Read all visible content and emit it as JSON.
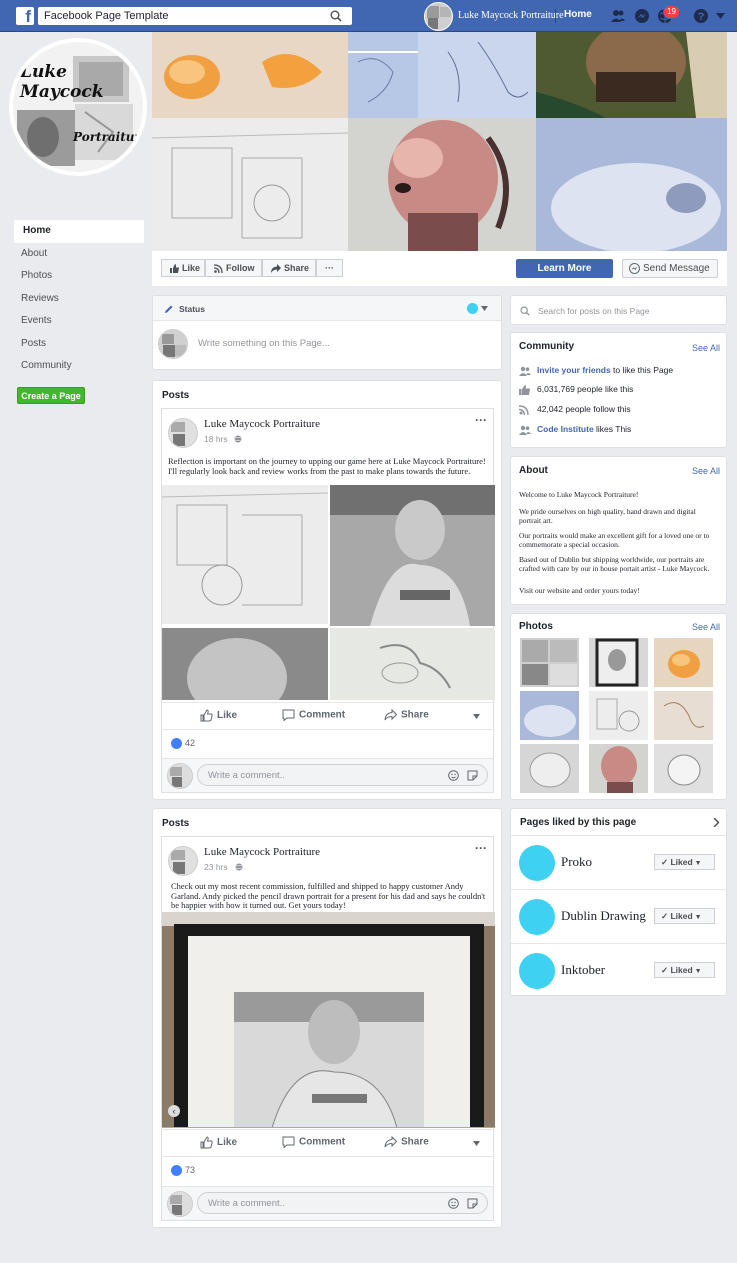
{
  "topbar": {
    "search_value": "Facebook Page Template",
    "page_name": "Luke Maycock Portraiture",
    "home_label": "Home",
    "notification_count": "19"
  },
  "profile": {
    "logo_line1": "Luke",
    "logo_line2": "Maycock",
    "logo_line3": "Portraiture"
  },
  "sidebar": {
    "items": [
      {
        "label": "Home"
      },
      {
        "label": "About"
      },
      {
        "label": "Photos"
      },
      {
        "label": "Reviews"
      },
      {
        "label": "Events"
      },
      {
        "label": "Posts"
      },
      {
        "label": "Community"
      }
    ],
    "create_page": "Create a Page"
  },
  "actions": {
    "like": "Like",
    "follow": "Follow",
    "share": "Share",
    "more": "···",
    "learn_more": "Learn More",
    "send_message": "Send Message"
  },
  "status": {
    "label": "Status",
    "placeholder": "Write something on this Page..."
  },
  "posts_section": [
    {
      "title": "Posts",
      "author": "Luke Maycock Portraiture",
      "time": "18 hrs",
      "text": "Reflection is important on the journey to upping our game here at Luke Maycock Portraiture! I'll regularly look back and review works from the past to make plans towards the future.",
      "like": "Like",
      "comment": "Comment",
      "share": "Share",
      "likes": "42",
      "comment_placeholder": "Write a comment.."
    },
    {
      "title": "Posts",
      "author": "Luke Maycock Portraiture",
      "time": "23 hrs",
      "text": "Check out my most recent commission, fulfilled and shipped to happy customer Andy Garland. Andy picked the pencil drawn portrait for a present for his dad and says he couldn't be happier with how it turned out. Get yours today!",
      "like": "Like",
      "comment": "Comment",
      "share": "Share",
      "likes": "73",
      "comment_placeholder": "Write a comment.."
    }
  ],
  "right": {
    "search_placeholder": "Search for posts on this Page",
    "community": {
      "title": "Community",
      "see_all": "See All",
      "invite_link": "Invite your friends",
      "invite_rest": " to like this Page",
      "likes": "6,031,769 people like this",
      "follows": "42,042 people follow this",
      "ci_link": "Code Institute",
      "ci_rest": " likes This"
    },
    "about": {
      "title": "About",
      "see_all": "See All",
      "p1": "Welcome to Luke Maycock Portraiture!",
      "p2": "We pride ourselves on high quality, hand drawn and digital portrait art.",
      "p3": "Our portraits would make an excellent gift for a loved one or to commemorate a special occasion.",
      "p4": "Based out of Dublin but shipping worldwide, our portraits are crafted with care by our in house portait artist - Luke Maycock.",
      "p5": "Visit our website and order yours today!"
    },
    "photos": {
      "title": "Photos",
      "see_all": "See All"
    },
    "pages_liked": {
      "title": "Pages liked by this page",
      "liked_label": "Liked",
      "pages": [
        {
          "name": "Proko"
        },
        {
          "name": "Dublin Drawing"
        },
        {
          "name": "Inktober"
        }
      ]
    }
  },
  "colors": {
    "brand": "#4267b2",
    "accent_cyan": "#3fd1f2",
    "green": "#42b72a",
    "badge": "#fa3e3e"
  }
}
